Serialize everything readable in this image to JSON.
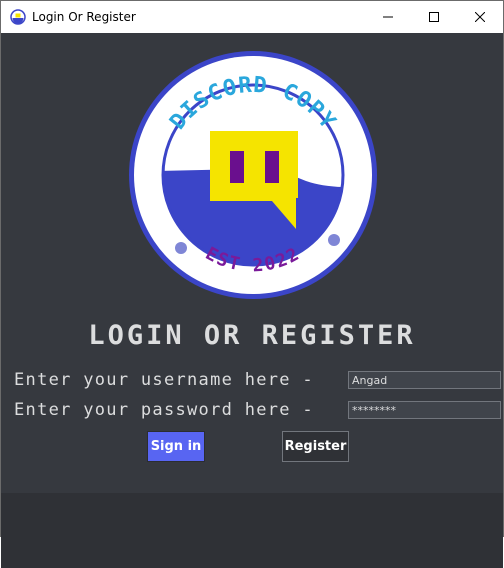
{
  "window": {
    "title": "Login Or Register"
  },
  "logo": {
    "top_text": "DISCORD COPY",
    "bottom_text": "EST 2022",
    "colors": {
      "ring": "#3b45c8",
      "arc_text": "#2aa7dc",
      "est_text": "#7a1a9a",
      "mascot": "#f5e400",
      "eyes": "#6a0f8e",
      "water": "#3b45c8"
    }
  },
  "form": {
    "heading": "LOGIN OR REGISTER",
    "username_label": "Enter your username here -",
    "password_label": "Enter your password here -",
    "username_value": "Angad",
    "password_value": "********"
  },
  "buttons": {
    "signin_label": "Sign in",
    "register_label": "Register"
  },
  "theme": {
    "background": "#36393f",
    "accent": "#5865f2",
    "text": "#dcddde"
  }
}
